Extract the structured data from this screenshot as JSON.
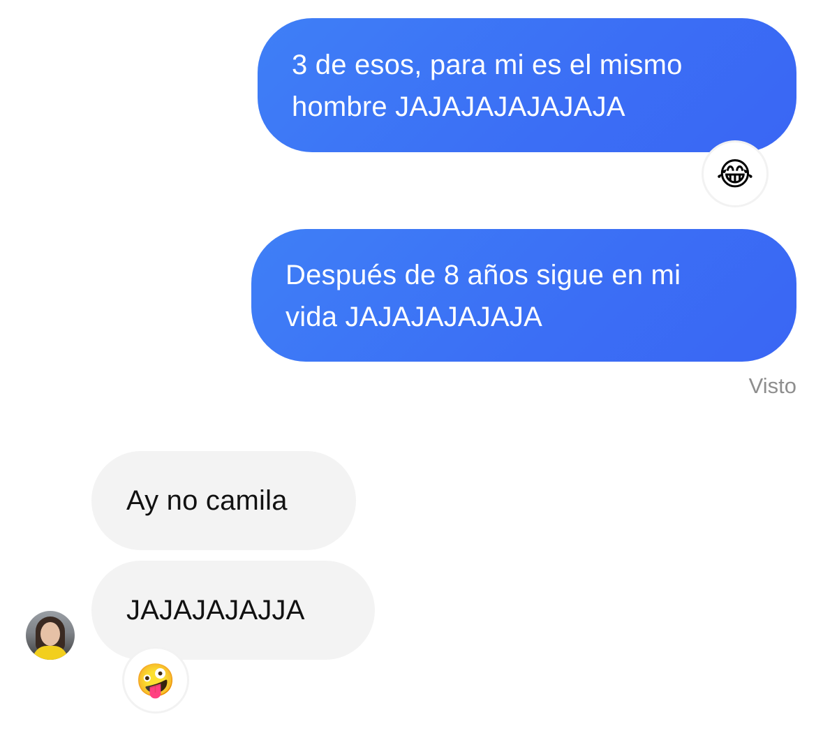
{
  "conversation": {
    "messages": [
      {
        "direction": "outgoing",
        "line1": "3 de esos, para mi es el mismo",
        "line2": "hombre JAJAJAJAJAJAJA",
        "reaction": "😂",
        "reaction_name": "face-with-tears-of-joy"
      },
      {
        "direction": "outgoing",
        "line1": "Después de 8 años sigue en mi",
        "line2": "vida JAJAJAJAJAJA"
      },
      {
        "direction": "incoming",
        "text": "Ay no camila"
      },
      {
        "direction": "incoming",
        "text": "JAJAJAJAJJA",
        "reaction": "🤪",
        "reaction_name": "zany-face"
      }
    ],
    "seen_label": "Visto"
  },
  "colors": {
    "outgoing_bubble": "#3b6ef5",
    "incoming_bubble": "#f3f3f3",
    "seen_text": "#8e8e8e"
  },
  "icons": {
    "avatar": "contact-avatar-photo"
  }
}
